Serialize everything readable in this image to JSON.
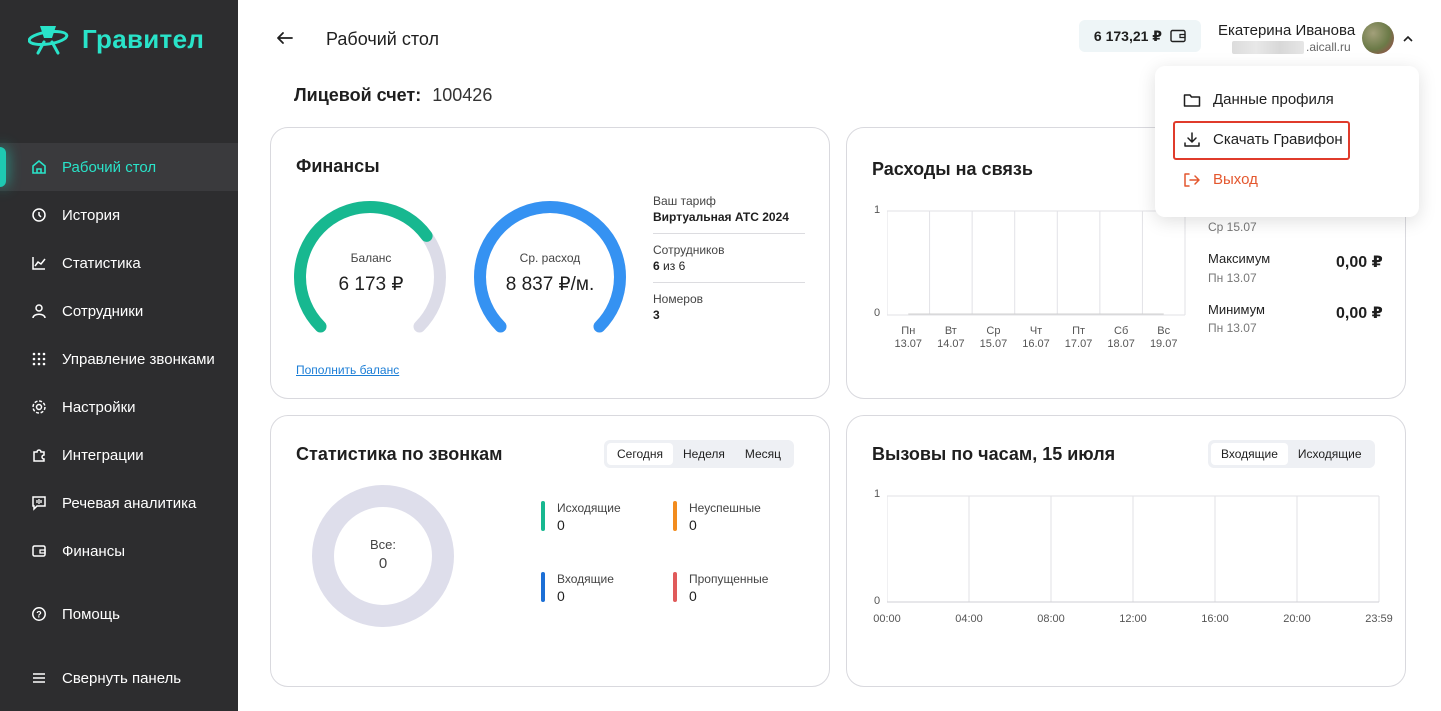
{
  "app": {
    "brand": "Гравител"
  },
  "sidebar": {
    "items": [
      {
        "label": "Рабочий стол",
        "icon": "home-icon",
        "active": true
      },
      {
        "label": "История",
        "icon": "history-icon"
      },
      {
        "label": "Статистика",
        "icon": "chart-icon"
      },
      {
        "label": "Сотрудники",
        "icon": "user-icon"
      },
      {
        "label": "Управление звонками",
        "icon": "dialpad-icon"
      },
      {
        "label": "Настройки",
        "icon": "gear-icon"
      },
      {
        "label": "Интеграции",
        "icon": "puzzle-icon"
      },
      {
        "label": "Речевая аналитика",
        "icon": "speech-icon"
      },
      {
        "label": "Финансы",
        "icon": "wallet-icon"
      }
    ],
    "help": "Помощь",
    "collapse": "Свернуть панель"
  },
  "header": {
    "title": "Рабочий стол",
    "balance": "6 173,21 ₽",
    "user_name": "Екатерина Иванова",
    "user_email_domain": ".aicall.ru"
  },
  "account": {
    "label": "Лицевой счет:",
    "number": "100426"
  },
  "finances": {
    "title": "Финансы",
    "balance_label": "Баланс",
    "balance_value": "6 173 ₽",
    "balance_fill": 0.7,
    "avg_label": "Ср. расход",
    "avg_value": "8 837 ₽/м.",
    "avg_fill": 1.0,
    "tariff_label": "Ваш тариф",
    "tariff_value": "Виртуальная АТС 2024",
    "employees_label": "Сотрудников",
    "employees_count": "6",
    "employees_of": "из 6",
    "numbers_label": "Номеров",
    "numbers_value": "3",
    "topup_link": "Пополнить баланс"
  },
  "expenses": {
    "title": "Расходы на связь",
    "y_ticks": [
      "1",
      "0"
    ],
    "days": [
      {
        "d": "Пн",
        "date": "13.07"
      },
      {
        "d": "Вт",
        "date": "14.07"
      },
      {
        "d": "Ср",
        "date": "15.07"
      },
      {
        "d": "Чт",
        "date": "16.07"
      },
      {
        "d": "Пт",
        "date": "17.07"
      },
      {
        "d": "Сб",
        "date": "18.07"
      },
      {
        "d": "Вс",
        "date": "19.07"
      }
    ],
    "partial_sub": "Ср 15.07",
    "max_label": "Максимум",
    "max_sub": "Пн 13.07",
    "max_value": "0,00 ₽",
    "min_label": "Минимум",
    "min_sub": "Пн 13.07",
    "min_value": "0,00 ₽"
  },
  "call_stats": {
    "title": "Статистика по звонкам",
    "tabs": [
      "Сегодня",
      "Неделя",
      "Месяц"
    ],
    "active_tab": 0,
    "total_label": "Все:",
    "total_value": "0",
    "legend": [
      {
        "label": "Исходящие",
        "value": "0",
        "color": "#17b890"
      },
      {
        "label": "Неуспешные",
        "value": "0",
        "color": "#f28c1e"
      },
      {
        "label": "Входящие",
        "value": "0",
        "color": "#1c6fd6"
      },
      {
        "label": "Пропущенные",
        "value": "0",
        "color": "#e05a5a"
      }
    ]
  },
  "hourly": {
    "title": "Вызовы по часам, 15 июля",
    "tabs": [
      "Входящие",
      "Исходящие"
    ],
    "active_tab": 0,
    "y_ticks": [
      "1",
      "0"
    ],
    "x_ticks": [
      "00:00",
      "04:00",
      "08:00",
      "12:00",
      "16:00",
      "20:00",
      "23:59"
    ]
  },
  "dropdown": {
    "items": [
      {
        "label": "Данные профиля",
        "icon": "folder-icon"
      },
      {
        "label": "Скачать Гравифон",
        "icon": "download-icon"
      },
      {
        "label": "Выход",
        "icon": "logout-icon"
      }
    ]
  },
  "colors": {
    "accent": "#29e3c9",
    "gauge_green": "#17b890",
    "gauge_blue": "#3592f2",
    "gauge_track": "#dcdce8",
    "sidebar_bg": "#2d2d2f"
  }
}
